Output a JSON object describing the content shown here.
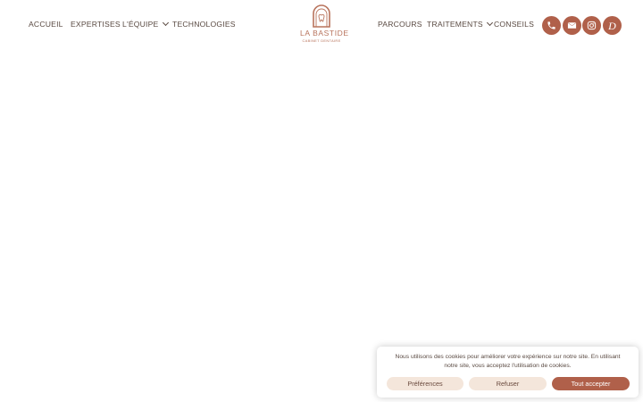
{
  "nav": {
    "left": [
      {
        "label": "ACCUEIL"
      },
      {
        "label": "EXPERTISES"
      },
      {
        "label": "L'ÉQUIPE"
      },
      {
        "label": "TECHNOLOGIES"
      }
    ],
    "right": [
      {
        "label": "PARCOURS"
      },
      {
        "label": "TRAITEMENTS"
      },
      {
        "label": "CONSEILS"
      }
    ]
  },
  "logo": {
    "title": "LA BASTIDE",
    "subtitle": "CABINET DENTAIRE"
  },
  "social": {
    "icons": [
      "phone-icon",
      "envelope-icon",
      "instagram-icon",
      "doctolib-icon"
    ],
    "doctolib_glyph": "D"
  },
  "cookie": {
    "text": "Nous utilisons des cookies pour améliorer votre expérience sur notre site. En utilisant notre site, vous acceptez l'utilisation de cookies.",
    "preferences_label": "Préférences",
    "refuse_label": "Refuser",
    "accept_label": "Tout accepter"
  },
  "colors": {
    "accent": "#b0604a",
    "logo": "#b8735c",
    "text": "#5a4a42",
    "button_light": "#f4e6db"
  }
}
